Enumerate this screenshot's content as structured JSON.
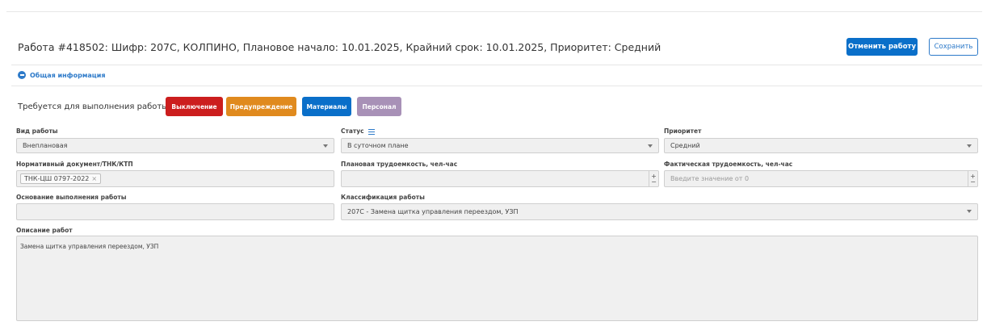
{
  "header": {
    "title": "Работа #418502: Шифр: 207С, КОЛПИНО, Плановое начало: 10.01.2025, Крайний срок: 10.01.2025, Приоритет: Средний",
    "cancel_label": "Отменить работу",
    "save_label": "Сохранить"
  },
  "section": {
    "title": "Общая информация"
  },
  "requirements": {
    "label": "Требуется для выполнения работы:",
    "tags": [
      {
        "label": "Выключение",
        "color": "#cc1e1e"
      },
      {
        "label": "Предупреждение",
        "color": "#e08a1e"
      },
      {
        "label": "Материалы",
        "color": "#0a6fc9"
      },
      {
        "label": "Персонал",
        "color": "#a891b7"
      }
    ]
  },
  "fields": {
    "work_type": {
      "label": "Вид работы",
      "value": "Внеплановая"
    },
    "status": {
      "label": "Статус",
      "value": "В суточном плане"
    },
    "priority": {
      "label": "Приоритет",
      "value": "Средний"
    },
    "norm_doc": {
      "label": "Нормативный документ/ТНК/КТП",
      "chip": "ТНК-ЦШ 0797-2022"
    },
    "planned_effort": {
      "label": "Плановая трудоемкость, чел-час",
      "value": ""
    },
    "actual_effort": {
      "label": "Фактическая трудоемкость, чел-час",
      "placeholder": "Введите значение от 0"
    },
    "basis": {
      "label": "Основание выполнения работы",
      "value": ""
    },
    "classification": {
      "label": "Классификация работы",
      "value": "207С - Замена щитка управления переездом, УЗП"
    },
    "description": {
      "label": "Описание работ",
      "value": "Замена щитка управления переездом, УЗП"
    }
  },
  "colors": {
    "accent": "#2d7ac9",
    "primary_button": "#0a6fc9"
  }
}
